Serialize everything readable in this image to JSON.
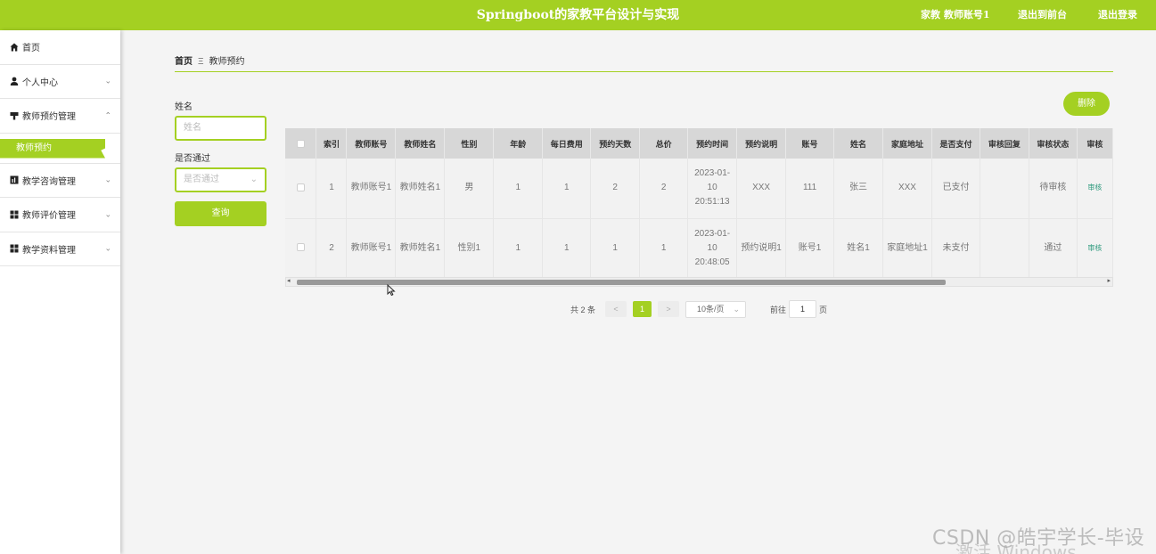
{
  "header": {
    "title": "Springboot的家教平台设计与实现",
    "user_label": "家教 教师账号1",
    "back_label": "退出到前台",
    "logout_label": "退出登录"
  },
  "sidebar": {
    "home": "首页",
    "personal": "个人中心",
    "appointment_mgmt": "教师预约管理",
    "appointment_sub": "教师预约",
    "consult_mgmt": "教学咨询管理",
    "review_mgmt": "教师评价管理",
    "material_mgmt": "教学资料管理"
  },
  "breadcrumb": {
    "home": "首页",
    "current": "教师预约"
  },
  "search": {
    "name_label": "姓名",
    "name_placeholder": "姓名",
    "passed_label": "是否通过",
    "passed_placeholder": "是否通过",
    "query_label": "查询"
  },
  "toolbar": {
    "delete_label": "删除"
  },
  "table": {
    "headers": [
      "索引",
      "教师账号",
      "教师姓名",
      "性别",
      "年龄",
      "每日费用",
      "预约天数",
      "总价",
      "预约时间",
      "预约说明",
      "账号",
      "姓名",
      "家庭地址",
      "是否支付",
      "审核回复",
      "审核状态",
      "审核"
    ],
    "rows": [
      [
        "1",
        "教师账号1",
        "教师姓名1",
        "男",
        "1",
        "1",
        "2",
        "2",
        "2023-01-10 20:51:13",
        "XXX",
        "111",
        "张三",
        "XXX",
        "已支付",
        "",
        "待审核",
        "审核"
      ],
      [
        "2",
        "教师账号1",
        "教师姓名1",
        "性别1",
        "1",
        "1",
        "1",
        "1",
        "2023-01-10 20:48:05",
        "预约说明1",
        "账号1",
        "姓名1",
        "家庭地址1",
        "未支付",
        "",
        "通过",
        "审核"
      ]
    ]
  },
  "pagination": {
    "total_text": "共 2 条",
    "prev": "<",
    "current_page": "1",
    "next": ">",
    "page_size": "10条/页",
    "goto_label": "前往",
    "goto_value": "1",
    "page_unit": "页"
  },
  "watermark": {
    "csdn": "CSDN @皓宇学长-毕设",
    "windows": "激活 Windows"
  },
  "colors": {
    "accent": "#a4d022",
    "background": "#f4f4f4"
  }
}
